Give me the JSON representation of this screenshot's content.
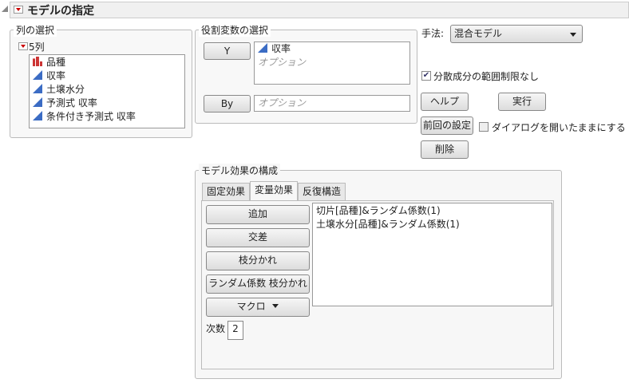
{
  "header": {
    "title": "モデルの指定"
  },
  "columns": {
    "legend": "列の選択",
    "count_label": "5列",
    "items": [
      {
        "label": "品種",
        "type": "nominal"
      },
      {
        "label": "収率",
        "type": "continuous"
      },
      {
        "label": "土壌水分",
        "type": "continuous"
      },
      {
        "label": "予測式 収率",
        "type": "continuous"
      },
      {
        "label": "条件付き予測式 収率",
        "type": "continuous"
      }
    ]
  },
  "roles": {
    "legend": "役割変数の選択",
    "y_label": "Y",
    "y_value": "収率",
    "y_optional": "オプション",
    "by_label": "By",
    "by_placeholder": "オプション"
  },
  "method": {
    "label": "手法:",
    "value": "混合モデル"
  },
  "options": {
    "unbounded_variance": "分散成分の範囲制限なし",
    "keep_open": "ダイアログを開いたままにする"
  },
  "buttons": {
    "help": "ヘルプ",
    "run": "実行",
    "recall": "前回の設定",
    "remove": "削除"
  },
  "effects": {
    "legend": "モデル効果の構成",
    "tabs": [
      "固定効果",
      "変量効果",
      "反復構造"
    ],
    "active_tab": 1,
    "add": "追加",
    "cross": "交差",
    "nest": "枝分かれ",
    "random_nest": "ランダム係数 枝分かれ",
    "macros": "マクロ",
    "degree_label": "次数",
    "degree": "2",
    "items": [
      "切片[品種]&ランダム係数(1)",
      "土壌水分[品種]&ランダム係数(1)"
    ]
  }
}
